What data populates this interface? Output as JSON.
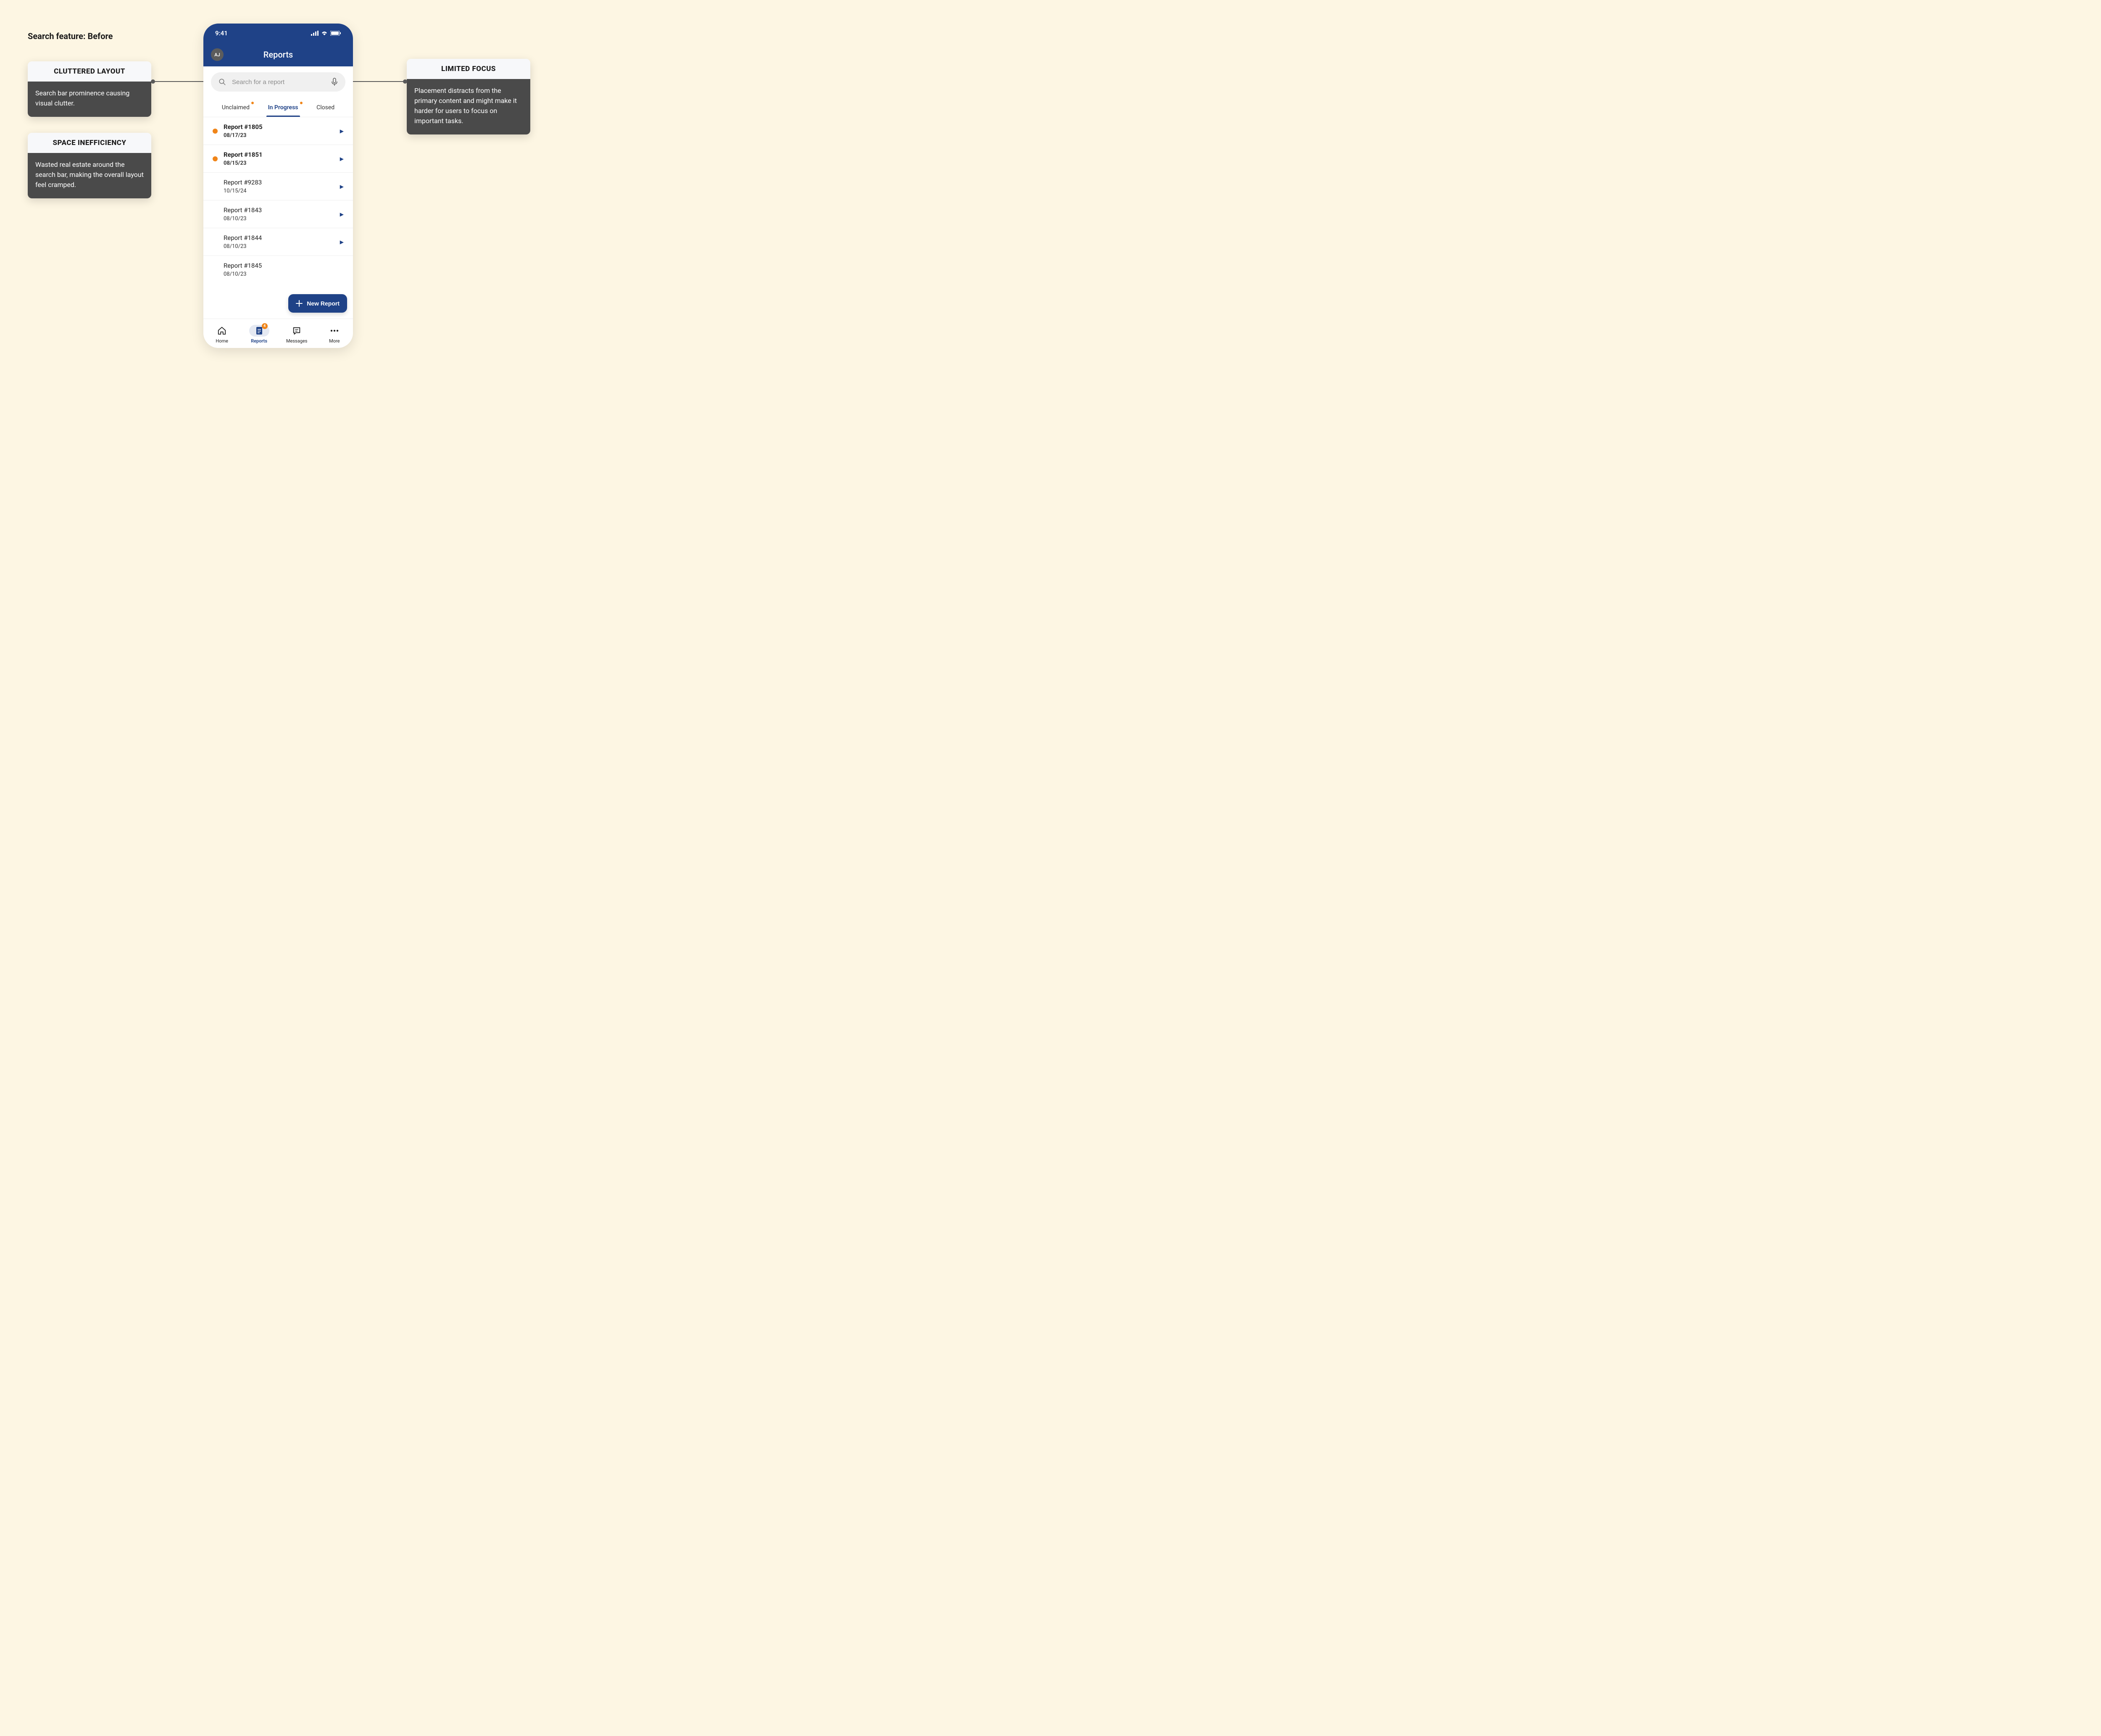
{
  "pageTitle": "Search feature: Before",
  "statusbar": {
    "time": "9:41"
  },
  "header": {
    "avatar": "AJ",
    "title": "Reports"
  },
  "search": {
    "placeholder": "Search for a report"
  },
  "tabs": [
    {
      "label": "Unclaimed",
      "active": false,
      "dot": true
    },
    {
      "label": "In Progress",
      "active": true,
      "dot": true
    },
    {
      "label": "Closed",
      "active": false,
      "dot": false
    }
  ],
  "reports": [
    {
      "title": "Report #1805",
      "date": "08/17/23",
      "unread": true
    },
    {
      "title": "Report #1851",
      "date": "08/15/23",
      "unread": true
    },
    {
      "title": "Report #9283",
      "date": "10/15/24",
      "unread": false
    },
    {
      "title": "Report #1843",
      "date": "08/10/23",
      "unread": false
    },
    {
      "title": "Report #1844",
      "date": "08/10/23",
      "unread": false
    },
    {
      "title": "Report #1845",
      "date": "08/10/23",
      "unread": false
    }
  ],
  "newReportLabel": "New Report",
  "bottomNav": {
    "items": [
      {
        "label": "Home",
        "icon": "home",
        "active": false,
        "badge": null
      },
      {
        "label": "Reports",
        "icon": "reports",
        "active": true,
        "badge": "4"
      },
      {
        "label": "Messages",
        "icon": "messages",
        "active": false,
        "badge": null
      },
      {
        "label": "More",
        "icon": "more",
        "active": false,
        "badge": null
      }
    ]
  },
  "annotations": {
    "cluttered": {
      "title": "CLUTTERED LAYOUT",
      "body": "Search bar prominence causing visual clutter."
    },
    "space": {
      "title": "SPACE INEFFICIENCY",
      "body": "Wasted real estate around the search bar, making the overall layout feel cramped."
    },
    "focus": {
      "title": "LIMITED FOCUS",
      "body": "Placement distracts from the primary content and might make it harder for users to focus on important tasks."
    }
  }
}
